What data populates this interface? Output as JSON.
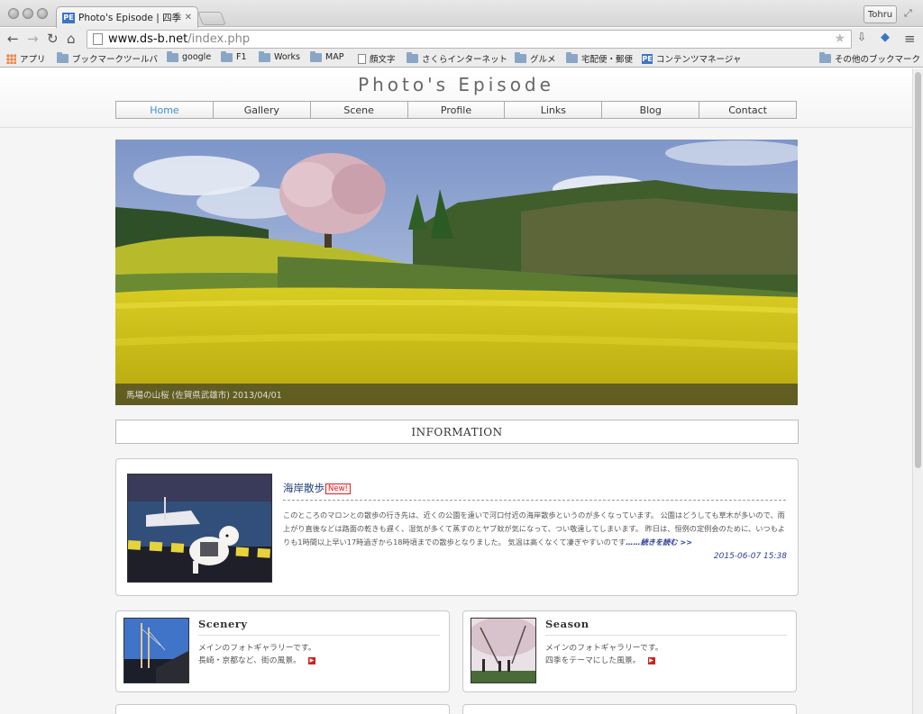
{
  "browser": {
    "tab_title": "Photo's Episode | 四季の風景",
    "tab_favicon": "PE",
    "user_name": "Tohru",
    "url_host": "www.ds-b.net",
    "url_path": "/index.php",
    "bookmarks": [
      {
        "label": "アプリ",
        "icon": "apps-icon"
      },
      {
        "label": "ブックマークツールバ",
        "icon": "folder-icon"
      },
      {
        "label": "google",
        "icon": "folder-icon"
      },
      {
        "label": "F1",
        "icon": "folder-icon"
      },
      {
        "label": "Works",
        "icon": "folder-icon"
      },
      {
        "label": "MAP",
        "icon": "folder-icon"
      },
      {
        "label": "顔文字",
        "icon": "page-icon"
      },
      {
        "label": "さくらインターネット",
        "icon": "folder-icon"
      },
      {
        "label": "グルメ",
        "icon": "folder-icon"
      },
      {
        "label": "宅配便・郵便",
        "icon": "folder-icon"
      },
      {
        "label": "コンテンツマネージャ",
        "icon": "pe-icon"
      }
    ],
    "other_bookmarks": "その他のブックマーク"
  },
  "site": {
    "title": "Photo's Episode",
    "nav": [
      "Home",
      "Gallery",
      "Scene",
      "Profile",
      "Links",
      "Blog",
      "Contact"
    ],
    "active_nav": "Home"
  },
  "hero": {
    "caption": "馬場の山桜 (佐賀県武雄市) 2013/04/01"
  },
  "information": {
    "heading": "INFORMATION",
    "post": {
      "title": "海岸散歩",
      "badge": "New!",
      "body": "このところのマロンとの散歩の行き先は、近くの公園を遠いで河口付近の海岸散歩というのが多くなっています。 公園はどうしても草木が多いので、雨上がり直後などは路面の乾きも遅く、湿気が多くて蒸すのとヤブ蚊が気になって、つい敬遠してしまいます。 昨日は、恒例の定例会のために、いつもよりも1時間以上早い17時過ぎから18時頃までの散歩となりました。 気温は高くなくて凄ぎやすいのです",
      "more": "……続きを読む >>",
      "date": "2015-06-07 15:38"
    }
  },
  "cards": [
    {
      "title": "Scenery",
      "line1": "メインのフォトギャラリーです。",
      "line2": "長崎・京都など、街の風景。"
    },
    {
      "title": "Season",
      "line1": "メインのフォトギャラリーです。",
      "line2": "四季をテーマにした風景。"
    }
  ],
  "colors": {
    "nav_active": "#3d8ed1",
    "link": "#2a3f9c",
    "badge": "#dd2222"
  }
}
